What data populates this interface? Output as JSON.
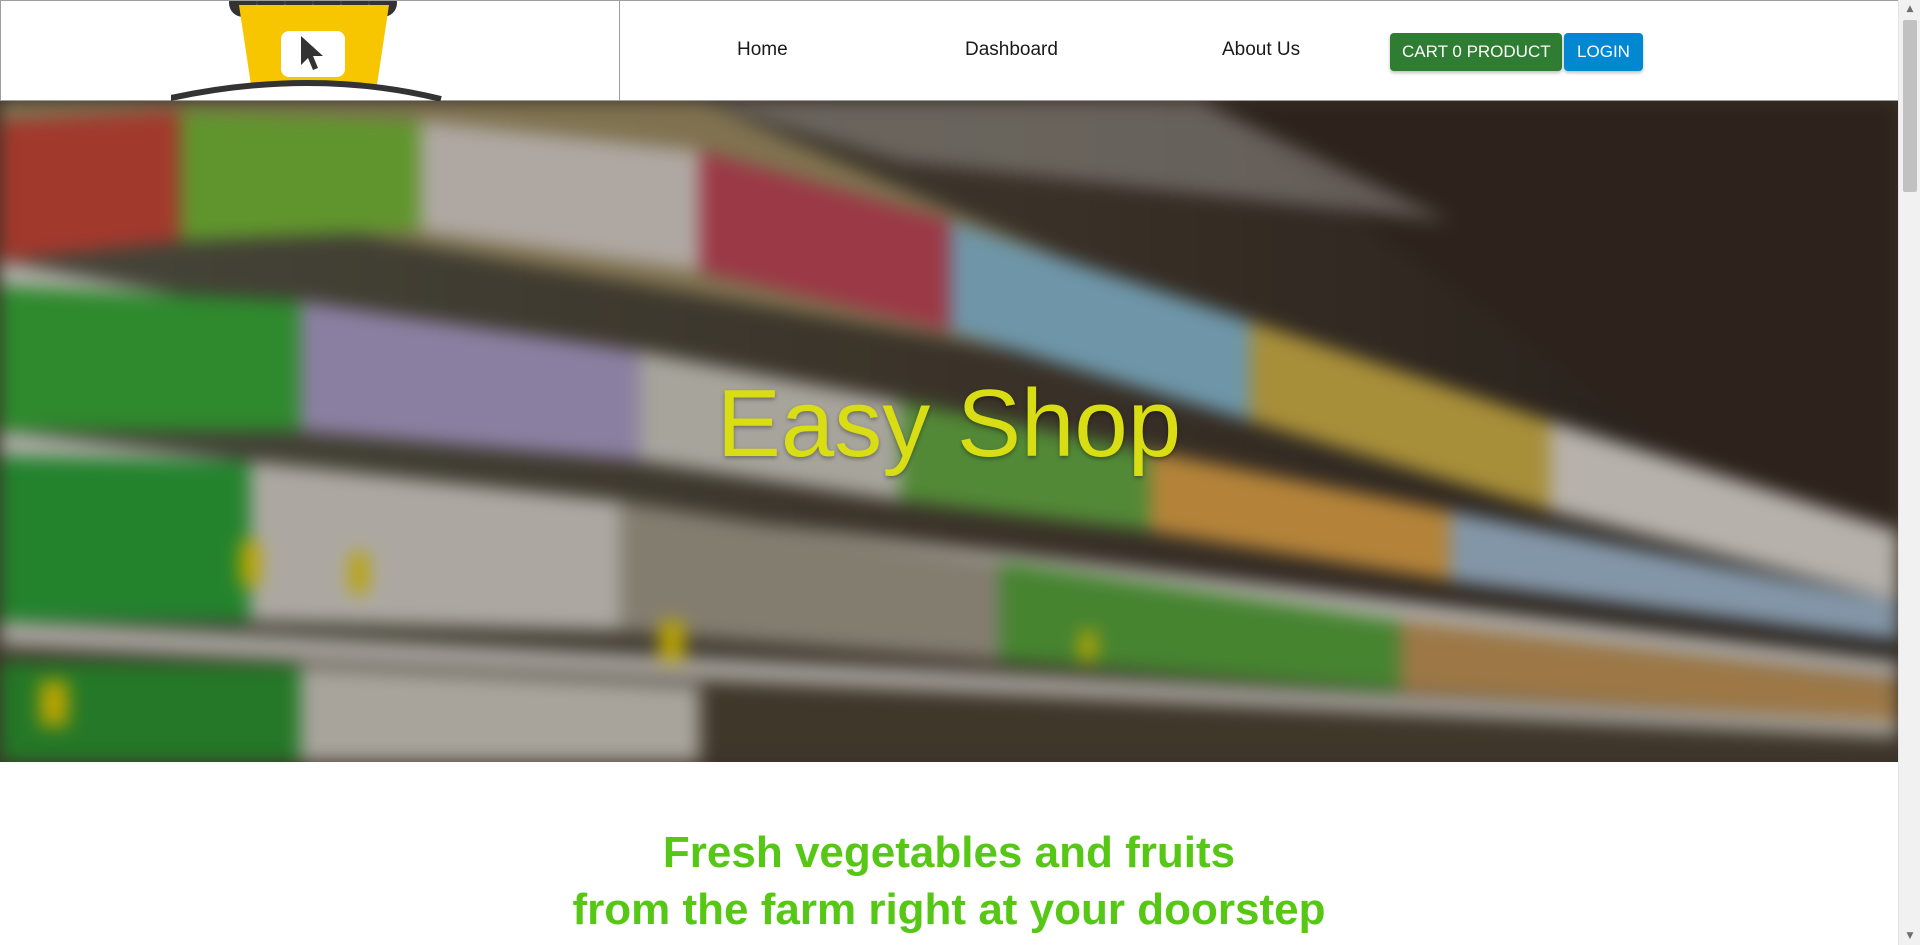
{
  "header": {
    "nav": [
      {
        "label": "Home"
      },
      {
        "label": "Dashboard"
      },
      {
        "label": "About Us"
      }
    ],
    "cart_button": "CART 0 PRODUCT",
    "login_button": "LOGIN"
  },
  "logo": {
    "icon": "cart-cursor-logo-icon",
    "colors": {
      "body": "#f7c600",
      "dark": "#333333"
    }
  },
  "hero": {
    "title": "Easy Shop",
    "background": "blurred-supermarket-shelves-image",
    "title_color": "#d9dd14"
  },
  "tagline": {
    "line1": "Fresh vegetables and fruits",
    "line2": "from the farm right at your doorstep",
    "color": "#55c714"
  },
  "colors": {
    "cart_button": "#2e7d32",
    "login_button": "#0288d1"
  }
}
